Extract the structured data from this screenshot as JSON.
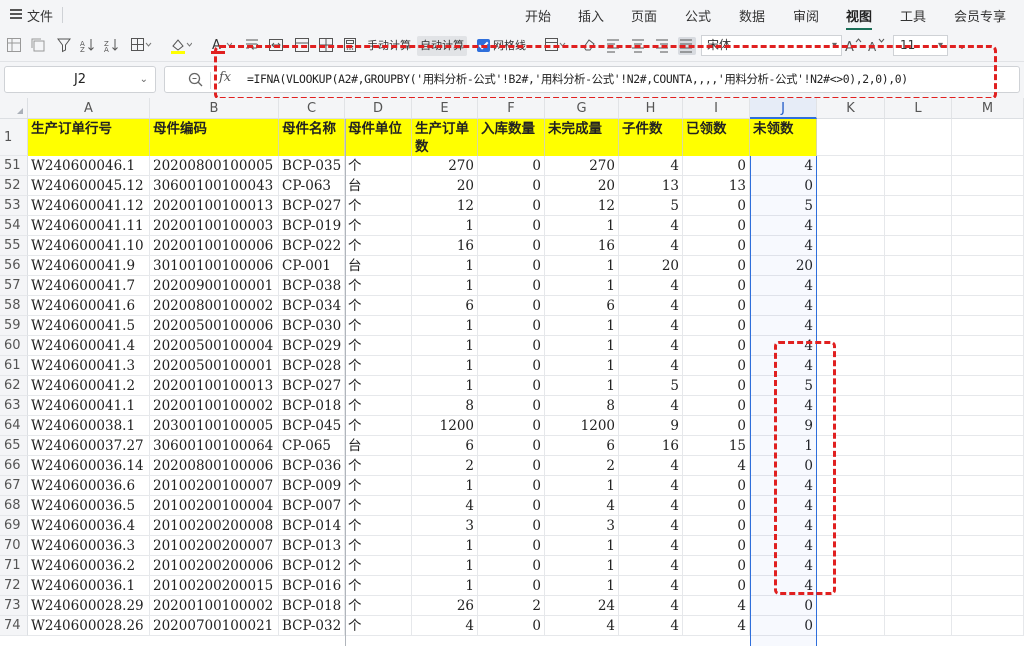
{
  "menu": {
    "file_label": "文件",
    "tabs": [
      "开始",
      "插入",
      "页面",
      "公式",
      "数据",
      "审阅",
      "视图",
      "工具",
      "会员专享"
    ],
    "active_tab": "视图"
  },
  "toolbar": {
    "manual_calc": "手动计算",
    "auto_calc": "自动计算",
    "gridlines_label": "网格线",
    "gridlines_checked": true,
    "font_name": "宋体",
    "font_size": "11"
  },
  "formula_bar": {
    "name_box": "J2",
    "fx_label": "fx",
    "formula": "=IFNA(VLOOKUP(A2#,GROUPBY('用料分析-公式'!B2#,'用料分析-公式'!N2#,COUNTA,,,,'用料分析-公式'!N2#<>0),2,0),0)"
  },
  "sheet": {
    "columns": [
      "A",
      "B",
      "C",
      "D",
      "E",
      "F",
      "G",
      "H",
      "I",
      "J",
      "K",
      "L",
      "M"
    ],
    "selected_column": "J",
    "header_row_number": "1",
    "headers": [
      "生产订单行号",
      "母件编码",
      "母件名称",
      "母件单位",
      "生产订单数",
      "入库数量",
      "未完成量",
      "子件数",
      "已领数",
      "未领数"
    ],
    "header_fill_color": "#ffff00",
    "annotation_color": "#e02020",
    "rows": [
      {
        "n": "51",
        "c": [
          "W240600046.1",
          "20200800100005",
          "BCP-035",
          "个",
          "270",
          "0",
          "270",
          "4",
          "0",
          "4"
        ]
      },
      {
        "n": "52",
        "c": [
          "W240600045.12",
          "30600100100043",
          "CP-063",
          "台",
          "20",
          "0",
          "20",
          "13",
          "13",
          "0"
        ]
      },
      {
        "n": "53",
        "c": [
          "W240600041.12",
          "20200100100013",
          "BCP-027",
          "个",
          "12",
          "0",
          "12",
          "5",
          "0",
          "5"
        ]
      },
      {
        "n": "54",
        "c": [
          "W240600041.11",
          "20200100100003",
          "BCP-019",
          "个",
          "1",
          "0",
          "1",
          "4",
          "0",
          "4"
        ]
      },
      {
        "n": "55",
        "c": [
          "W240600041.10",
          "20200100100006",
          "BCP-022",
          "个",
          "16",
          "0",
          "16",
          "4",
          "0",
          "4"
        ]
      },
      {
        "n": "56",
        "c": [
          "W240600041.9",
          "30100100100006",
          "CP-001",
          "台",
          "1",
          "0",
          "1",
          "20",
          "0",
          "20"
        ]
      },
      {
        "n": "57",
        "c": [
          "W240600041.7",
          "20200900100001",
          "BCP-038",
          "个",
          "1",
          "0",
          "1",
          "4",
          "0",
          "4"
        ]
      },
      {
        "n": "58",
        "c": [
          "W240600041.6",
          "20200800100002",
          "BCP-034",
          "个",
          "6",
          "0",
          "6",
          "4",
          "0",
          "4"
        ]
      },
      {
        "n": "59",
        "c": [
          "W240600041.5",
          "20200500100006",
          "BCP-030",
          "个",
          "1",
          "0",
          "1",
          "4",
          "0",
          "4"
        ]
      },
      {
        "n": "60",
        "c": [
          "W240600041.4",
          "20200500100004",
          "BCP-029",
          "个",
          "1",
          "0",
          "1",
          "4",
          "0",
          "4"
        ]
      },
      {
        "n": "61",
        "c": [
          "W240600041.3",
          "20200500100001",
          "BCP-028",
          "个",
          "1",
          "0",
          "1",
          "4",
          "0",
          "4"
        ]
      },
      {
        "n": "62",
        "c": [
          "W240600041.2",
          "20200100100013",
          "BCP-027",
          "个",
          "1",
          "0",
          "1",
          "5",
          "0",
          "5"
        ]
      },
      {
        "n": "63",
        "c": [
          "W240600041.1",
          "20200100100002",
          "BCP-018",
          "个",
          "8",
          "0",
          "8",
          "4",
          "0",
          "4"
        ]
      },
      {
        "n": "64",
        "c": [
          "W240600038.1",
          "20300100100005",
          "BCP-045",
          "个",
          "1200",
          "0",
          "1200",
          "9",
          "0",
          "9"
        ]
      },
      {
        "n": "65",
        "c": [
          "W240600037.27",
          "30600100100064",
          "CP-065",
          "台",
          "6",
          "0",
          "6",
          "16",
          "15",
          "1"
        ]
      },
      {
        "n": "66",
        "c": [
          "W240600036.14",
          "20200800100006",
          "BCP-036",
          "个",
          "2",
          "0",
          "2",
          "4",
          "4",
          "0"
        ]
      },
      {
        "n": "67",
        "c": [
          "W240600036.6",
          "20100200100007",
          "BCP-009",
          "个",
          "1",
          "0",
          "1",
          "4",
          "0",
          "4"
        ]
      },
      {
        "n": "68",
        "c": [
          "W240600036.5",
          "20100200100004",
          "BCP-007",
          "个",
          "4",
          "0",
          "4",
          "4",
          "0",
          "4"
        ]
      },
      {
        "n": "69",
        "c": [
          "W240600036.4",
          "20100200200008",
          "BCP-014",
          "个",
          "3",
          "0",
          "3",
          "4",
          "0",
          "4"
        ]
      },
      {
        "n": "70",
        "c": [
          "W240600036.3",
          "20100200200007",
          "BCP-013",
          "个",
          "1",
          "0",
          "1",
          "4",
          "0",
          "4"
        ]
      },
      {
        "n": "71",
        "c": [
          "W240600036.2",
          "20100200200006",
          "BCP-012",
          "个",
          "1",
          "0",
          "1",
          "4",
          "0",
          "4"
        ]
      },
      {
        "n": "72",
        "c": [
          "W240600036.1",
          "20100200200015",
          "BCP-016",
          "个",
          "1",
          "0",
          "1",
          "4",
          "0",
          "4"
        ]
      },
      {
        "n": "73",
        "c": [
          "W240600028.29",
          "20200100100002",
          "BCP-018",
          "个",
          "26",
          "2",
          "24",
          "4",
          "4",
          "0"
        ]
      },
      {
        "n": "74",
        "c": [
          "W240600028.26",
          "20200700100021",
          "BCP-032",
          "个",
          "4",
          "0",
          "4",
          "4",
          "4",
          "0"
        ]
      }
    ]
  }
}
